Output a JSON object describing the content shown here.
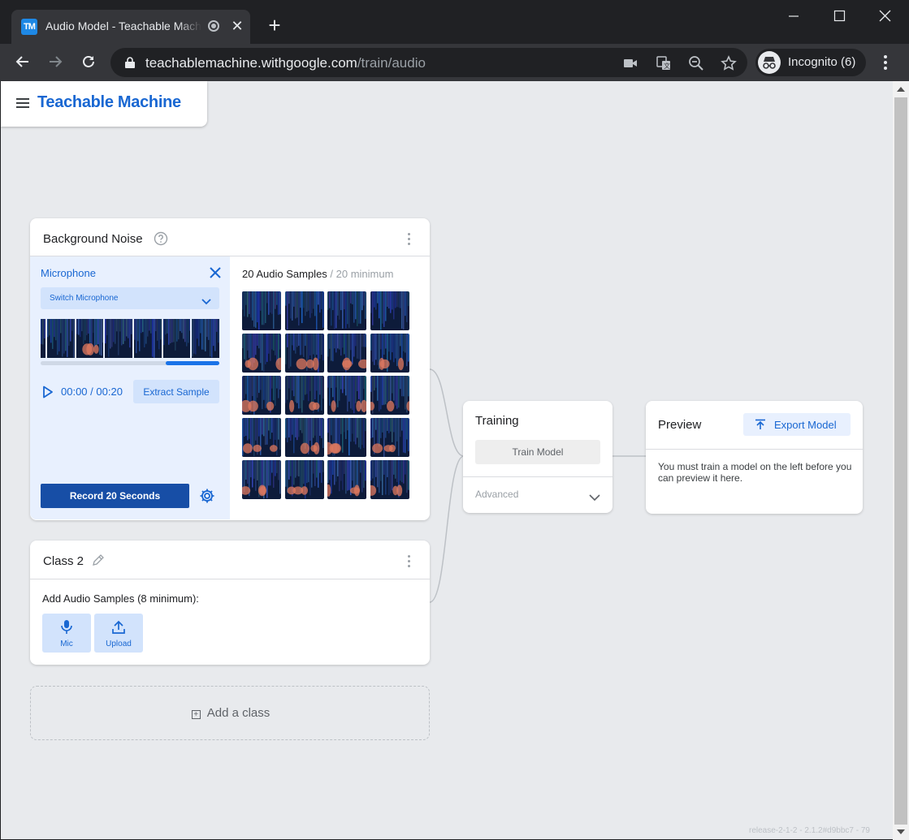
{
  "browser": {
    "tab_title": "Audio Model - Teachable Machine",
    "tab_favicon_text": "TM",
    "url_host": "teachablemachine.withgoogle.com",
    "url_path": "/train/audio",
    "incognito_label": "Incognito (6)",
    "icons": [
      "back-arrow-icon",
      "forward-arrow-icon",
      "reload-icon",
      "lock-icon",
      "camera-icon",
      "translate-icon",
      "zoom-out-icon",
      "star-icon",
      "incognito-icon",
      "more-vert-icon"
    ]
  },
  "app": {
    "brand": "Teachable Machine",
    "version": "release-2-1-2 - 2.1.2#d9bbc7 - 79"
  },
  "background_noise": {
    "title": "Background Noise",
    "microphone": {
      "title": "Microphone",
      "switch_label": "Switch Microphone",
      "time_current": "00:00",
      "time_total": "00:20",
      "extract_label": "Extract Sample",
      "record_label": "Record 20 Seconds",
      "record_progress": 0.3
    },
    "samples_count": "20 Audio Samples",
    "samples_min": " / 20 minimum",
    "sample_count_value": 20
  },
  "class2": {
    "title": "Class 2",
    "add_samples_text": "Add Audio Samples (8 minimum):",
    "mic_label": "Mic",
    "upload_label": "Upload"
  },
  "add_class_label": "Add a class",
  "training": {
    "title": "Training",
    "train_button": "Train Model",
    "advanced_label": "Advanced"
  },
  "preview": {
    "title": "Preview",
    "export_button": "Export Model",
    "message": "You must train a model on the left before you can preview it here."
  },
  "colors": {
    "accent": "#1967d2",
    "accent_dark": "#174ea6",
    "panel_bg": "#e8f0fe",
    "page_bg": "#e8eaed"
  }
}
